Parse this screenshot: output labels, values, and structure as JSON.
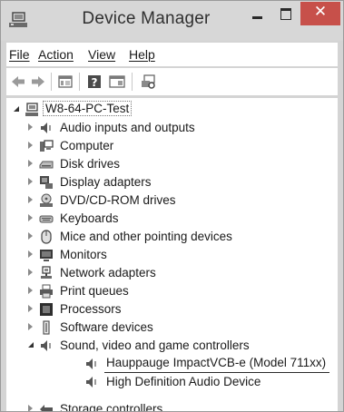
{
  "window": {
    "title": "Device Manager",
    "close_glyph": "✕"
  },
  "menu": [
    {
      "label": "File"
    },
    {
      "label": "Action"
    },
    {
      "label": "View"
    },
    {
      "label": "Help"
    }
  ],
  "tree": {
    "root": {
      "label": "W8-64-PC-Test",
      "icon": "computer-monitor-icon"
    },
    "categories": [
      {
        "label": "Audio inputs and outputs",
        "icon": "speaker-icon"
      },
      {
        "label": "Computer",
        "icon": "computer-icon"
      },
      {
        "label": "Disk drives",
        "icon": "disk-drive-icon"
      },
      {
        "label": "Display adapters",
        "icon": "display-adapter-icon"
      },
      {
        "label": "DVD/CD-ROM drives",
        "icon": "dvd-drive-icon"
      },
      {
        "label": "Keyboards",
        "icon": "keyboard-icon"
      },
      {
        "label": "Mice and other pointing devices",
        "icon": "mouse-icon"
      },
      {
        "label": "Monitors",
        "icon": "monitor-icon"
      },
      {
        "label": "Network adapters",
        "icon": "network-adapter-icon"
      },
      {
        "label": "Print queues",
        "icon": "printer-icon"
      },
      {
        "label": "Processors",
        "icon": "processor-icon"
      },
      {
        "label": "Software devices",
        "icon": "software-device-icon"
      },
      {
        "label": "Sound, video and game controllers",
        "icon": "speaker-icon",
        "children": [
          {
            "label": "Hauppauge ImpactVCB-e (Model 711xx)",
            "icon": "speaker-icon"
          },
          {
            "label": "High Definition Audio Device",
            "icon": "speaker-icon"
          }
        ]
      },
      {
        "label": "Storage controllers",
        "icon": "storage-controller-icon"
      }
    ]
  }
}
